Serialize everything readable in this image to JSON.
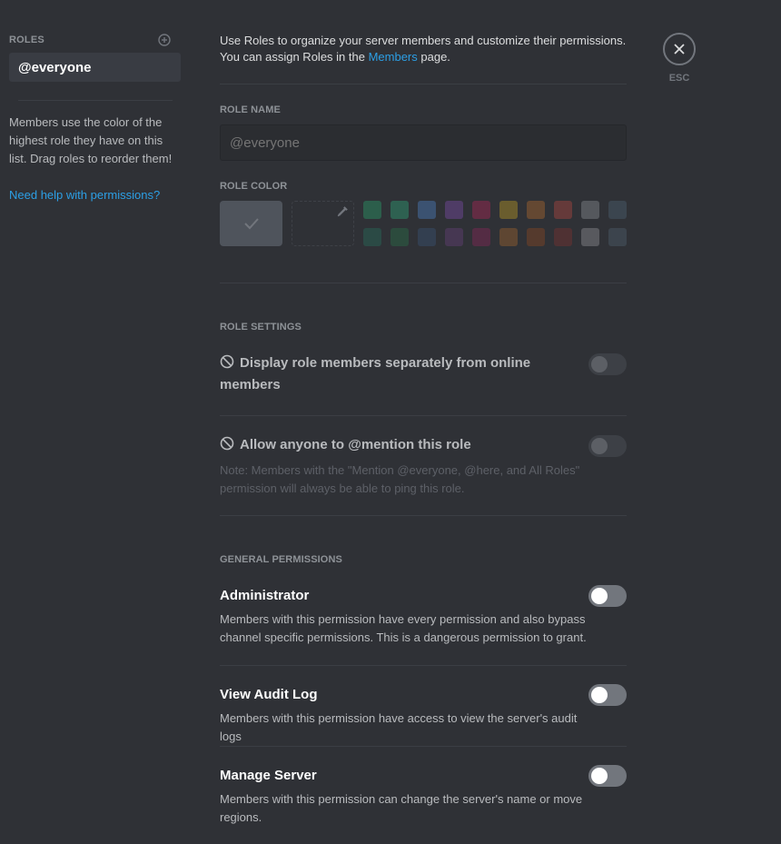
{
  "sidebar": {
    "roles_label": "ROLES",
    "roles": [
      {
        "label": "@everyone",
        "selected": true
      }
    ],
    "help_text": "Members use the color of the highest role they have on this list. Drag roles to reorder them!",
    "help_link": "Need help with permissions?"
  },
  "intro": {
    "text_before": "Use Roles to organize your server members and customize their permissions. You can assign Roles in the ",
    "link": "Members",
    "text_after": " page."
  },
  "close": {
    "label": "ESC",
    "icon": "close-icon"
  },
  "role_name": {
    "label": "ROLE NAME",
    "value": "",
    "placeholder": "@everyone"
  },
  "role_color": {
    "label": "ROLE COLOR",
    "default_selected": true,
    "swatches_row1": [
      "#2c5e4b",
      "#2e6151",
      "#3b5271",
      "#4f3c66",
      "#632c43",
      "#6a5d2e",
      "#644832",
      "#653a3a",
      "#55585d",
      "#3b454f"
    ],
    "swatches_row2": [
      "#2b4a45",
      "#2c4b3d",
      "#333f50",
      "#463752",
      "#542c44",
      "#5e4632",
      "#553a2d",
      "#4f3133",
      "#58595e",
      "#3c444d"
    ]
  },
  "role_settings": {
    "label": "ROLE SETTINGS",
    "items": [
      {
        "title": "Display role members separately from online members",
        "enabled": false,
        "disabled": true
      },
      {
        "title_before": "Allow anyone to ",
        "title_bold": "@mention",
        "title_after": " this role",
        "note": "Note: Members with the \"Mention @everyone, @here, and All Roles\" permission will always be able to ping this role.",
        "enabled": false,
        "disabled": true
      }
    ]
  },
  "general_permissions": {
    "label": "GENERAL PERMISSIONS",
    "items": [
      {
        "title": "Administrator",
        "description": "Members with this permission have every permission and also bypass channel specific permissions. This is a dangerous permission to grant.",
        "enabled": false
      },
      {
        "title": "View Audit Log",
        "description": "Members with this permission have access to view the server's audit logs",
        "enabled": false
      },
      {
        "title": "Manage Server",
        "description": "Members with this permission can change the server's name or move regions.",
        "enabled": false
      }
    ]
  },
  "colors": {
    "background": "#2f3136",
    "link": "#2c9fe5",
    "selected_role_bg": "#393c43",
    "toggle_off": "#72767d"
  }
}
